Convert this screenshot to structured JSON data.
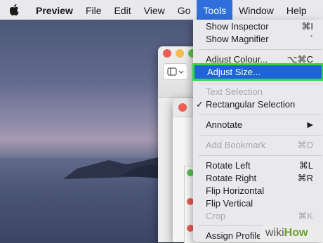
{
  "menubar": {
    "app_name": "Preview",
    "items": [
      "File",
      "Edit",
      "View",
      "Go",
      "Tools",
      "Window",
      "Help"
    ],
    "active_item": "Tools"
  },
  "tools_menu": {
    "show_inspector": {
      "label": "Show Inspector",
      "shortcut": "⌘I"
    },
    "show_magnifier": {
      "label": "Show Magnifier",
      "shortcut": "`"
    },
    "adjust_colour": {
      "label": "Adjust Colour...",
      "shortcut": "⌥⌘C"
    },
    "adjust_size": {
      "label": "Adjust Size...",
      "highlighted": true
    },
    "text_selection": {
      "label": "Text Selection",
      "disabled": true
    },
    "rectangular_selection": {
      "label": "Rectangular Selection",
      "checked": true,
      "check": "✓"
    },
    "annotate": {
      "label": "Annotate",
      "submenu_arrow": "▶"
    },
    "add_bookmark": {
      "label": "Add Bookmark",
      "shortcut": "⌘D",
      "disabled": true
    },
    "rotate_left": {
      "label": "Rotate Left",
      "shortcut": "⌘L"
    },
    "rotate_right": {
      "label": "Rotate Right",
      "shortcut": "⌘R"
    },
    "flip_horizontal": {
      "label": "Flip Horizontal"
    },
    "flip_vertical": {
      "label": "Flip Vertical"
    },
    "crop": {
      "label": "Crop",
      "shortcut": "⌘K",
      "disabled": true
    },
    "assign_profile": {
      "label": "Assign Profile..."
    }
  },
  "watermark": {
    "part1": "wiki",
    "part2": "How"
  },
  "colors": {
    "menu_highlight": "#1e64d8",
    "annotation_outline": "#33d83a",
    "traffic_red": "#ec5f57",
    "traffic_yellow": "#f5bd4f",
    "traffic_green": "#5fc453"
  }
}
